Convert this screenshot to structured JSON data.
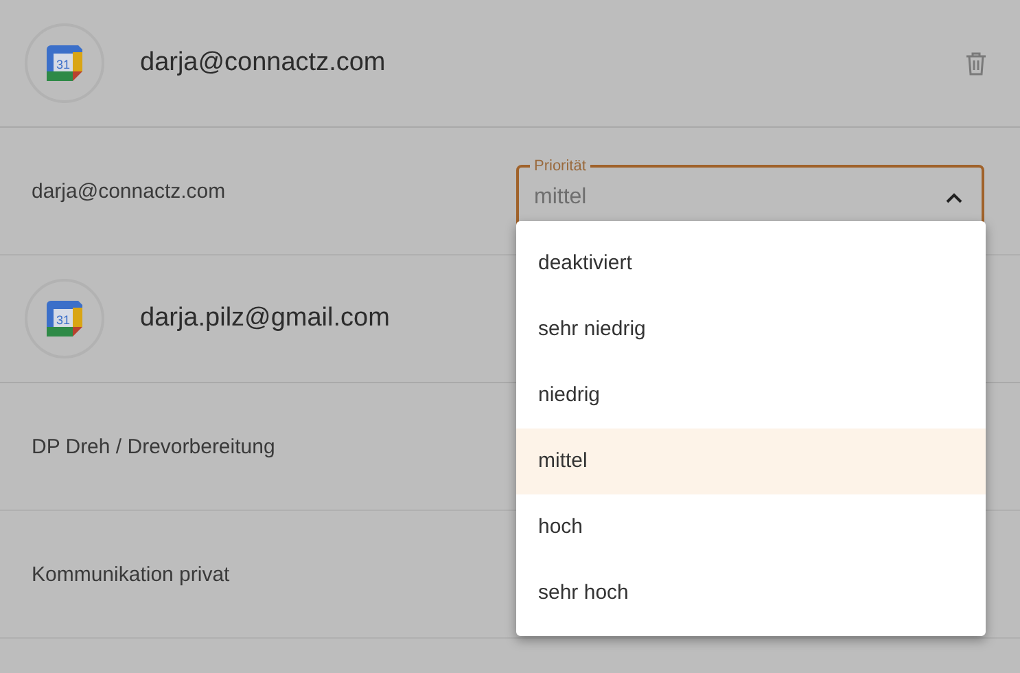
{
  "accounts": [
    {
      "email": "darja@connactz.com",
      "day": "31",
      "has_delete": true,
      "calendars": [
        {
          "name": "darja@connactz.com",
          "priority": {
            "label": "Priorität",
            "value": "mittel",
            "open": true,
            "options": [
              {
                "label": "deaktiviert",
                "selected": false
              },
              {
                "label": "sehr niedrig",
                "selected": false
              },
              {
                "label": "niedrig",
                "selected": false
              },
              {
                "label": "mittel",
                "selected": true
              },
              {
                "label": "hoch",
                "selected": false
              },
              {
                "label": "sehr hoch",
                "selected": false
              }
            ]
          }
        }
      ]
    },
    {
      "email": "darja.pilz@gmail.com",
      "day": "31",
      "has_delete": false,
      "calendars": [
        {
          "name": "DP Dreh / Drevorbereitung"
        },
        {
          "name": "Kommunikation privat"
        }
      ]
    }
  ]
}
